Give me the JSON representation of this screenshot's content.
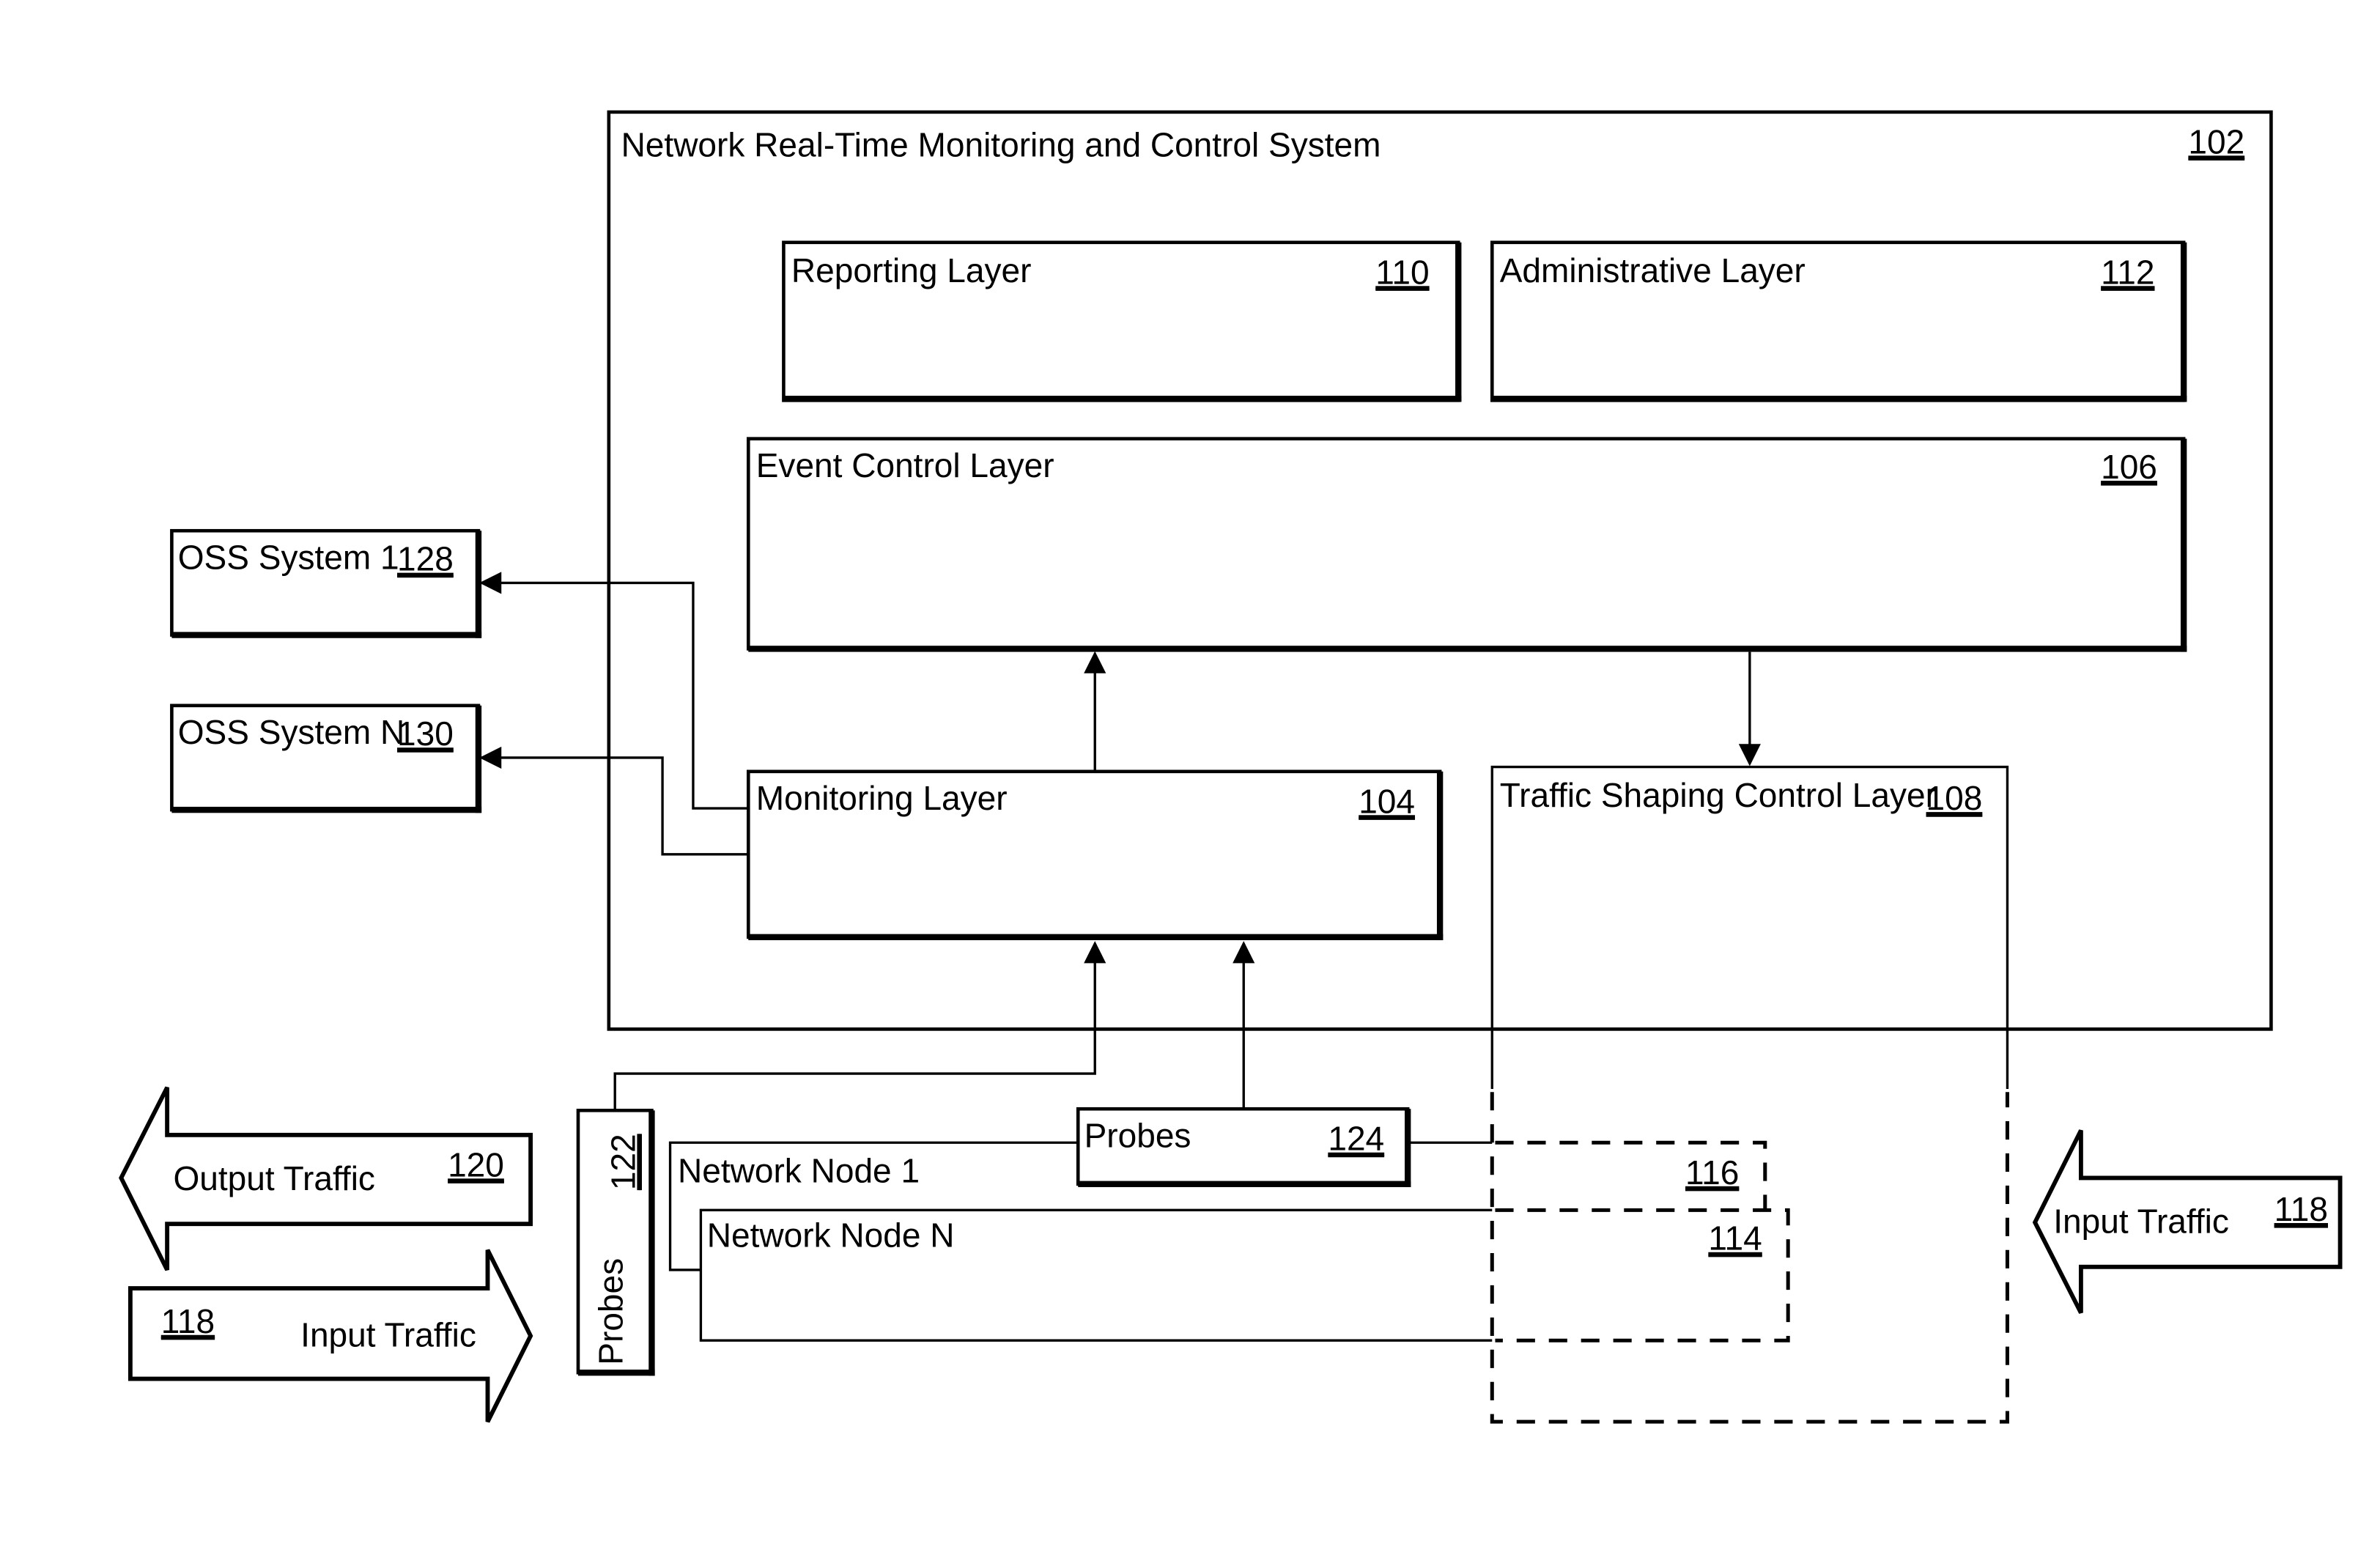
{
  "system": {
    "label": "Network Real-Time Monitoring and Control System",
    "ref": "102"
  },
  "layers": {
    "reporting": {
      "label": "Reporting Layer",
      "ref": "110"
    },
    "administrative": {
      "label": "Administrative Layer",
      "ref": "112"
    },
    "event_control": {
      "label": "Event Control Layer",
      "ref": "106"
    },
    "monitoring": {
      "label": "Monitoring Layer",
      "ref": "104"
    },
    "traffic_shaping": {
      "label": "Traffic Shaping Control Layer",
      "ref": "108"
    }
  },
  "oss": [
    {
      "label": "OSS System 1",
      "ref": "128"
    },
    {
      "label": "OSS System N",
      "ref": "130"
    }
  ],
  "probes_left": {
    "label": "Probes",
    "ref": "122"
  },
  "probes_mid": {
    "label": "Probes",
    "ref": "124"
  },
  "nodes": [
    {
      "label": "Network Node 1",
      "ref": "116"
    },
    {
      "label": "Network Node N",
      "ref": "114"
    }
  ],
  "traffic": {
    "output": {
      "label": "Output Traffic",
      "ref": "120"
    },
    "input_left": {
      "label": "Input Traffic",
      "ref": "118"
    },
    "input_right": {
      "label": "Input Traffic",
      "ref": "118"
    }
  }
}
